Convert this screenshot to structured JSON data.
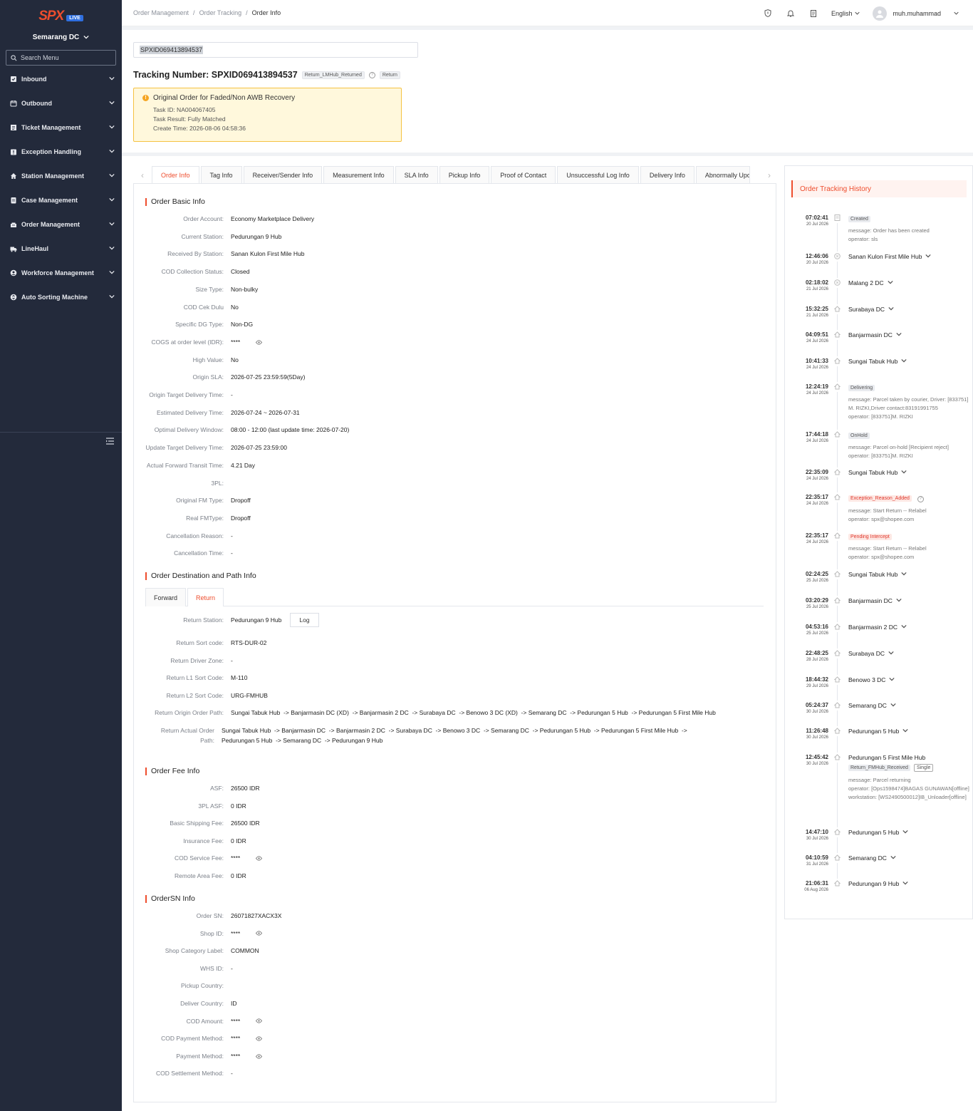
{
  "sidebar": {
    "logo": "SPX",
    "logo_badge": "LIVE",
    "station": "Semarang DC",
    "search_placeholder": "Search Menu",
    "items": [
      {
        "label": "Inbound",
        "icon": "inbound-icon"
      },
      {
        "label": "Outbound",
        "icon": "outbound-icon"
      },
      {
        "label": "Ticket Management",
        "icon": "ticket-icon"
      },
      {
        "label": "Exception Handling",
        "icon": "exception-icon"
      },
      {
        "label": "Station Management",
        "icon": "home-icon"
      },
      {
        "label": "Case Management",
        "icon": "case-icon"
      },
      {
        "label": "Order Management",
        "icon": "order-icon"
      },
      {
        "label": "LineHaul",
        "icon": "truck-icon"
      },
      {
        "label": "Workforce Management",
        "icon": "person-icon"
      },
      {
        "label": "Auto Sorting Machine",
        "icon": "sorting-icon"
      }
    ]
  },
  "header": {
    "breadcrumb": [
      "Order Management",
      "Order Tracking",
      "Order Info"
    ],
    "language": "English",
    "username": "muh.muhammad"
  },
  "top": {
    "search_value": "SPXID069413894537",
    "tracking_label": "Tracking Number: SPXID069413894537",
    "status_tag": "Return_LMHub_Returned",
    "type_tag": "Return",
    "notice": {
      "title": "Original Order for Faded/Non AWB Recovery",
      "task_id": "Task ID: NA004067405",
      "task_result": "Task Result: Fully Matched",
      "create_time": "Create Time: 2026-08-06 04:58:36"
    }
  },
  "tabs": [
    "Order Info",
    "Tag Info",
    "Receiver/Sender Info",
    "Measurement Info",
    "SLA Info",
    "Pickup Info",
    "Proof of Contact",
    "Unsuccessful Log Info",
    "Delivery Info",
    "Abnormally Upda"
  ],
  "basic_info": {
    "title": "Order Basic Info",
    "rows": [
      {
        "label": "Order Account:",
        "value": "Economy Marketplace Delivery"
      },
      {
        "label": "Current Station:",
        "value": "Pedurungan 9 Hub"
      },
      {
        "label": "Received By Station:",
        "value": "Sanan Kulon First Mile Hub"
      },
      {
        "label": "COD Collection Status:",
        "value": "Closed"
      },
      {
        "label": "Size Type:",
        "value": "Non-bulky"
      },
      {
        "label": "COD Cek Dulu",
        "value": "No"
      },
      {
        "label": "Specific DG Type:",
        "value": "Non-DG"
      },
      {
        "label": "COGS at order level (IDR):",
        "value": "****",
        "eye": true
      },
      {
        "label": "High Value:",
        "value": "No"
      },
      {
        "label": "Origin SLA:",
        "value": "2026-07-25 23:59:59(5Day)"
      },
      {
        "label": "Origin Target Delivery Time:",
        "value": "-"
      },
      {
        "label": "Estimated Delivery Time:",
        "value": "2026-07-24 ~ 2026-07-31"
      },
      {
        "label": "Optimal Delivery Window:",
        "value": "08:00 - 12:00 (last update time: 2026-07-20)"
      },
      {
        "label": "Update Target Delivery Time:",
        "value": "2026-07-25 23:59:00"
      },
      {
        "label": "Actual Forward Transit Time:",
        "value": "4.21 Day"
      },
      {
        "label": "3PL:",
        "value": ""
      },
      {
        "label": "Original FM Type:",
        "value": "Dropoff"
      },
      {
        "label": "Real FMType:",
        "value": "Dropoff"
      },
      {
        "label": "Cancellation Reason:",
        "value": "-"
      },
      {
        "label": "Cancellation Time:",
        "value": "-"
      }
    ]
  },
  "dest_info": {
    "title": "Order Destination and Path Info",
    "subtabs": [
      "Forward",
      "Return"
    ],
    "return_station_label": "Return Station:",
    "return_station": "Pedurungan 9 Hub",
    "log_button": "Log",
    "rows": [
      {
        "label": "Return Sort code:",
        "value": "RTS-DUR-02"
      },
      {
        "label": "Return Driver Zone:",
        "value": "-"
      },
      {
        "label": "Return L1 Sort Code:",
        "value": "M-110"
      },
      {
        "label": "Return L2 Sort Code:",
        "value": "URG-FMHUB"
      }
    ],
    "origin_path_label": "Return Origin Order Path:",
    "origin_path": "Sungai Tabuk Hub  -> Banjarmasin DC (XD)  -> Banjarmasin 2 DC  -> Surabaya DC  -> Benowo 3 DC (XD)  -> Semarang DC  -> Pedurungan 5 Hub  -> Pedurungan 5 First Mile Hub",
    "actual_path_label": "Return Actual Order Path:",
    "actual_path_1": "Sungai Tabuk Hub  -> Banjarmasin DC  -> Banjarmasin 2 DC  -> Surabaya DC  -> Benowo 3 DC  -> Semarang DC  -> Pedurungan 5 Hub  -> Pedurungan 5 First Mile Hub  ->",
    "actual_path_2": "Pedurungan 5 Hub  -> Semarang DC  -> Pedurungan 9 Hub"
  },
  "fee_info": {
    "title": "Order Fee Info",
    "rows": [
      {
        "label": "ASF:",
        "value": "26500 IDR"
      },
      {
        "label": "3PL ASF:",
        "value": "0 IDR"
      },
      {
        "label": "Basic Shipping Fee:",
        "value": "26500 IDR"
      },
      {
        "label": "Insurance Fee:",
        "value": "0 IDR"
      },
      {
        "label": "COD Service Fee:",
        "value": "****",
        "eye": true
      },
      {
        "label": "Remote Area Fee:",
        "value": "0 IDR"
      }
    ]
  },
  "sn_info": {
    "title": "OrderSN Info",
    "rows": [
      {
        "label": "Order SN:",
        "value": "26071827XACX3X"
      },
      {
        "label": "Shop ID:",
        "value": "****",
        "eye": true
      },
      {
        "label": "Shop Category Label:",
        "value": "COMMON"
      },
      {
        "label": "WHS ID:",
        "value": "-"
      },
      {
        "label": "Pickup Country:",
        "value": ""
      },
      {
        "label": "Deliver Country:",
        "value": "ID"
      },
      {
        "label": "COD Amount:",
        "value": "****",
        "eye": true
      },
      {
        "label": "COD Payment Method:",
        "value": "****",
        "eye": true
      },
      {
        "label": "Payment Method:",
        "value": "****",
        "eye": true
      },
      {
        "label": "COD Settlement Method:",
        "value": "-"
      }
    ]
  },
  "history": {
    "title": "Order Tracking History",
    "events": [
      {
        "time": "07:02:41",
        "date": "20 Jul 2026",
        "chip": "Created",
        "msg": [
          "message: Order has been created",
          "operator: sls"
        ],
        "dot": "doc"
      },
      {
        "time": "12:46:06",
        "date": "20 Jul 2026",
        "loc": "Sanan Kulon First Mile Hub",
        "dot": "circle"
      },
      {
        "time": "02:18:02",
        "date": "21 Jul 2026",
        "loc": "Malang 2 DC",
        "dot": "circle"
      },
      {
        "time": "15:32:25",
        "date": "21 Jul 2026",
        "loc": "Surabaya DC",
        "dot": "house"
      },
      {
        "time": "04:09:51",
        "date": "24 Jul 2026",
        "loc": "Banjarmasin DC",
        "dot": "house"
      },
      {
        "time": "10:41:33",
        "date": "24 Jul 2026",
        "loc": "Sungai Tabuk Hub",
        "dot": "house"
      },
      {
        "time": "12:24:19",
        "date": "24 Jul 2026",
        "chip": "Delivering",
        "msg": [
          "message: Parcel taken by courier, Driver: [833751]M. RIZKI,Driver contact:83191991755",
          "operator: [833751]M. RIZKI"
        ],
        "dot": "house"
      },
      {
        "time": "17:44:18",
        "date": "24 Jul 2026",
        "chip": "OnHold",
        "msg": [
          "message: Parcel on-hold [Recipient reject]",
          "operator: [833751]M. RIZKI"
        ],
        "dot": "house"
      },
      {
        "time": "22:35:09",
        "date": "24 Jul 2026",
        "loc": "Sungai Tabuk Hub",
        "dot": "house"
      },
      {
        "time": "22:35:17",
        "date": "24 Jul 2026",
        "chip": "Exception_Reason_Added",
        "chip_red": true,
        "help": true,
        "msg": [
          "message: Start Return -- Relabel",
          "operator: spx@shopee.com"
        ],
        "dot": "house"
      },
      {
        "time": "22:35:17",
        "date": "24 Jul 2026",
        "chip": "Pending Intercept",
        "chip_red": true,
        "msg": [
          "message: Start Return -- Relabel",
          "operator: spx@shopee.com"
        ],
        "dot": "house"
      },
      {
        "time": "02:24:25",
        "date": "25 Jul 2026",
        "loc": "Sungai Tabuk Hub",
        "dot": "house"
      },
      {
        "time": "03:20:29",
        "date": "25 Jul 2026",
        "loc": "Banjarmasin DC",
        "dot": "house"
      },
      {
        "time": "04:53:16",
        "date": "25 Jul 2026",
        "loc": "Banjarmasin 2 DC",
        "dot": "house"
      },
      {
        "time": "22:48:25",
        "date": "28 Jul 2026",
        "loc": "Surabaya DC",
        "dot": "house"
      },
      {
        "time": "18:44:32",
        "date": "29 Jul 2026",
        "loc": "Benowo 3 DC",
        "dot": "house"
      },
      {
        "time": "05:24:37",
        "date": "30 Jul 2026",
        "loc": "Semarang DC",
        "dot": "house"
      },
      {
        "time": "11:26:48",
        "date": "30 Jul 2026",
        "loc": "Pedurungan 5 Hub",
        "dot": "house"
      },
      {
        "time": "12:45:42",
        "date": "30 Jul 2026",
        "loc": "Pedurungan 5 First Mile Hub",
        "nochev": true,
        "chip": "Return_FMHub_Received",
        "chip2": "Single",
        "msg": [
          "message: Parcel returning",
          "operator: [Ops1598474]BAGAS GUNAWAN[offline]",
          "workstation: [WS2490500012]IB_Unloader[offline]"
        ],
        "dot": "house"
      },
      {
        "time": "14:47:10",
        "date": "30 Jul 2026",
        "loc": "Pedurungan 5 Hub",
        "dot": "house"
      },
      {
        "time": "04:10:59",
        "date": "31 Jul 2026",
        "loc": "Semarang DC",
        "dot": "house"
      },
      {
        "time": "21:06:31",
        "date": "06 Aug 2026",
        "loc": "Pedurungan 9 Hub",
        "dot": "house",
        "last": true
      }
    ]
  }
}
